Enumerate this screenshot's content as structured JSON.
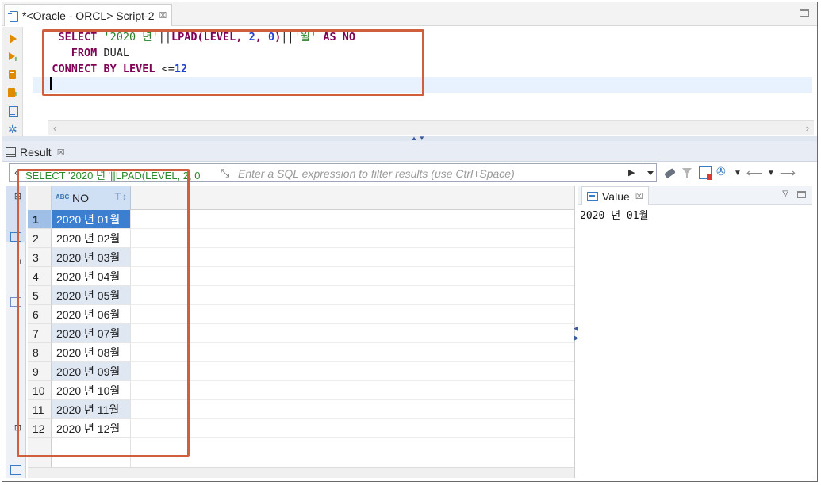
{
  "editor": {
    "tab_title": "*<Oracle - ORCL> Script-2",
    "tab_close": "☒",
    "code": {
      "l1": {
        "select": "SELECT",
        "s1": "'2020 년'",
        "bars1": "||",
        "lpad": "LPAD",
        "args1": "(LEVEL, ",
        "n2": "2",
        "comma": ", ",
        "n0": "0",
        "close": ")",
        "bars2": "||",
        "s2": "'월'",
        "as": "AS",
        "no": "NO"
      },
      "l2": {
        "from": "FROM",
        "dual": "DUAL"
      },
      "l3": {
        "connect": "CONNECT",
        "by": "BY",
        "level": "LEVEL",
        "op": "<=",
        "n12": "12"
      }
    }
  },
  "result_tab": {
    "label": "Result",
    "close": "☒"
  },
  "filter": {
    "sql_prefix": "SELECT '2020 년 '||LPAD(LEVEL, 2, 0",
    "placeholder": "Enter a SQL expression to filter results (use Ctrl+Space)"
  },
  "grid": {
    "column": "NO",
    "rows": [
      {
        "n": "1",
        "v": "2020 년 01월"
      },
      {
        "n": "2",
        "v": "2020 년 02월"
      },
      {
        "n": "3",
        "v": "2020 년 03월"
      },
      {
        "n": "4",
        "v": "2020 년 04월"
      },
      {
        "n": "5",
        "v": "2020 년 05월"
      },
      {
        "n": "6",
        "v": "2020 년 06월"
      },
      {
        "n": "7",
        "v": "2020 년 07월"
      },
      {
        "n": "8",
        "v": "2020 년 08월"
      },
      {
        "n": "9",
        "v": "2020 년 09월"
      },
      {
        "n": "10",
        "v": "2020 년 10월"
      },
      {
        "n": "11",
        "v": "2020 년 11월"
      },
      {
        "n": "12",
        "v": "2020 년 12월"
      }
    ],
    "selected_row": 1
  },
  "value_panel": {
    "tab_label": "Value",
    "close": "☒",
    "value": "2020 년 01월"
  },
  "accent_colors": {
    "highlight_box": "#d0603d",
    "selection": "#3c7fd0"
  }
}
